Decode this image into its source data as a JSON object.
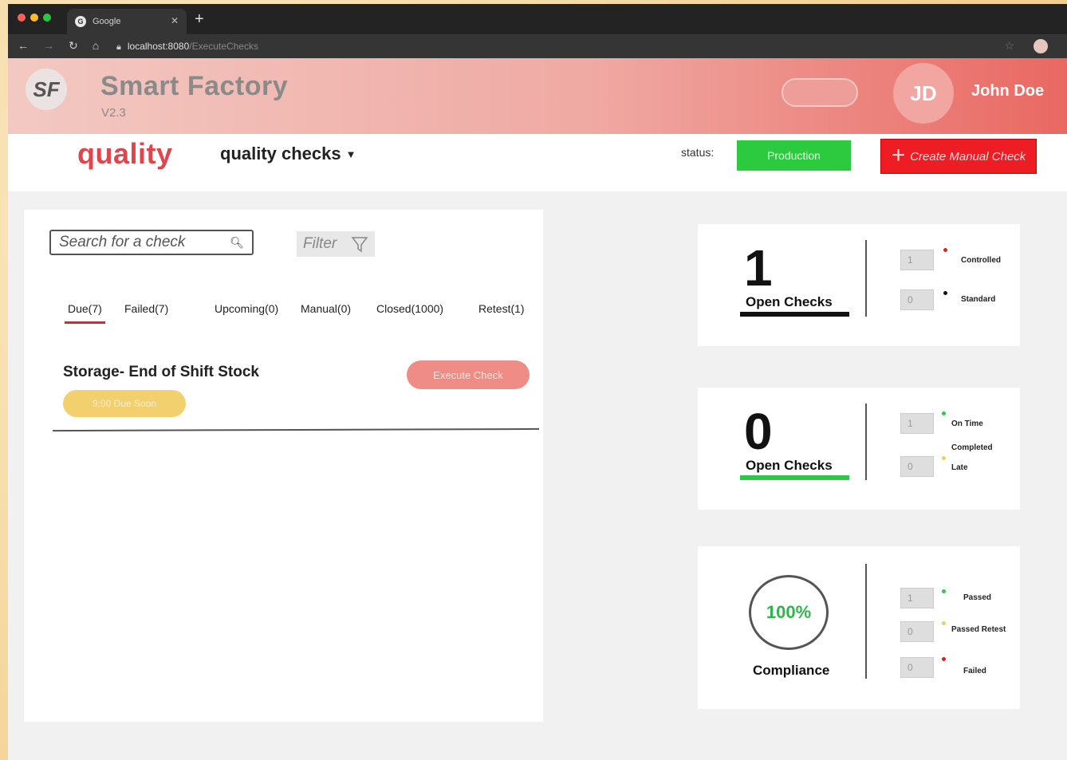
{
  "browser": {
    "tab_title": "Google",
    "tab_icon": "G",
    "url_host": "localhost:8080",
    "url_path": "/ExecuteChecks"
  },
  "header": {
    "logo": "SF",
    "title": "Smart Factory",
    "version": "V2.3",
    "avatar_initials": "JD",
    "user_name": "John Doe"
  },
  "subnav": {
    "section": "quality",
    "dropdown_label": "quality checks",
    "status_label": "status:",
    "status_value": "Production",
    "create_label": "Create Manual Check"
  },
  "checks": {
    "search_placeholder": "Search for a check",
    "filter_label": "Filter",
    "tabs": [
      {
        "label": "Due(7)",
        "active": true
      },
      {
        "label": "Failed(7)",
        "active": false
      },
      {
        "label": "Upcoming(0)",
        "active": false
      },
      {
        "label": "Manual(0)",
        "active": false
      },
      {
        "label": "Closed(1000)",
        "active": false
      },
      {
        "label": "Retest(1)",
        "active": false
      }
    ],
    "items": [
      {
        "title": "Storage- End of Shift Stock",
        "due": "9:00 Due Soon",
        "action": "Execute Check"
      }
    ]
  },
  "cards": [
    {
      "number": "1",
      "label": "Open Checks",
      "underline_color": "#111111",
      "rows": [
        {
          "value": "1",
          "dot_color": "#e02020",
          "label": "Controlled"
        },
        {
          "value": "0",
          "dot_color": "#111111",
          "label": "Standard"
        }
      ]
    },
    {
      "number": "0",
      "label": "Open Checks",
      "underline_color": "#2fc64a",
      "rows": [
        {
          "value": "1",
          "dot_color": "#2fc64a",
          "label": "On Time"
        },
        {
          "value": "0",
          "dot_color": "#f0d050",
          "label": "Late"
        }
      ],
      "extra_label": "Completed"
    },
    {
      "percent": "100%",
      "label": "Compliance",
      "rows": [
        {
          "value": "1",
          "dot_color": "#2fc64a",
          "label": "Passed"
        },
        {
          "value": "0",
          "dot_color": "#f0d050",
          "label": "Passed Retest"
        },
        {
          "value": "0",
          "dot_color": "#e02020",
          "label": "Failed"
        }
      ]
    }
  ],
  "colors": {
    "brand_red": "#e0454c",
    "status_green": "#2ccb3f",
    "create_red": "#ee1d24"
  }
}
